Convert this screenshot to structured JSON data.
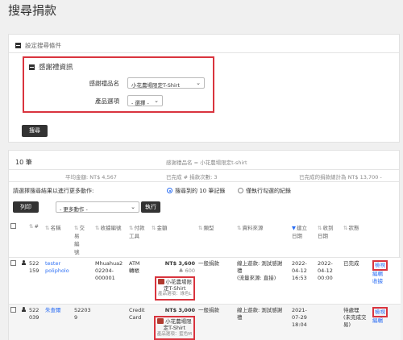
{
  "page_title": "搜尋捐款",
  "search_section": {
    "title": "設定搜尋條件",
    "gift_box_title": "感謝禮資訊",
    "gift_name_label": "感謝禮品名",
    "gift_name_value": "小花農場限定T-Shirt",
    "product_option_label": "產品選項",
    "product_option_value": "- 選擇 -",
    "search_button": "搜尋"
  },
  "results": {
    "count": "10 筆",
    "gift_filter_text": "感謝禮品名 = 小花農場限定t-shirt",
    "avg_amount": "平均金額: NT$ 4,567",
    "completed": "已完成 # 捐款次數: 3",
    "completed_total": "已完成的捐款總計為 NT$ 13,700 -",
    "bulk_prompt": "請選擇搜尋結果以進行更多動作:",
    "radio_all": "搜尋到的 10 筆記錄",
    "radio_checked": "僅執行勾選的紀錄",
    "print_button": "列印",
    "more_actions": "- 更多動作 -",
    "execute_button": "執行"
  },
  "table": {
    "headers": {
      "num": "#",
      "name": "名稱",
      "tx": "交\n易\n編\n號",
      "receipt": "收據編號",
      "pay": "付款\n工具",
      "amount": "金額",
      "type": "類型",
      "source": "資料來源",
      "created": "建立\n日期",
      "received": "收到\n日期",
      "status": "狀態"
    },
    "rows": [
      {
        "id": "522\n159",
        "name": "tester\npolipholo",
        "tx": "",
        "receipt": "Mhuahua2\n02204-\n000001",
        "pay": "ATM\n轉帳",
        "amount": "NT$ 3,600",
        "sub_amount": "600",
        "gift_name": "小花農場限\n定T-Shirt",
        "gift_option": "產品選項：綠色L",
        "type": "一般捐款",
        "source": "線上遊款: 測試感謝\n禮\n(流量來源: 直接)",
        "created": "2022-\n04-12\n16:53",
        "received": "2022-\n04-12\n00:00",
        "status": "已完成",
        "action1": "檢視",
        "action2": "編輯",
        "action3": "收據"
      },
      {
        "id": "522\n039",
        "name": "朱查爾",
        "tx": "52203\n9",
        "receipt": "",
        "pay": "Credit\nCard",
        "amount": "NT$ 3,000",
        "gift_name": "小花農場限\n定T-Shirt",
        "gift_option": "產品選項：藍色M",
        "type": "一般捐款",
        "source": "線上遊款: 測試感謝\n禮",
        "created": "2021-\n07-29\n18:04",
        "received": "",
        "status": "待處理\n(未完成交\n易)",
        "action1": "檢視",
        "action2": "編輯"
      }
    ]
  }
}
